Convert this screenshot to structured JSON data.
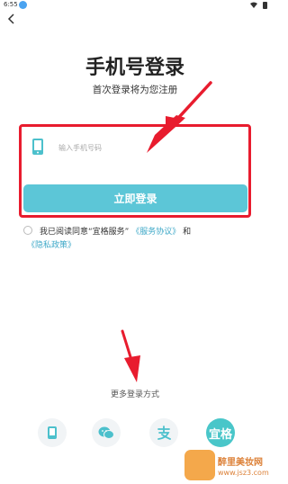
{
  "status_bar": {
    "time": "6:55",
    "notification_count": "0"
  },
  "header": {
    "title": "手机号登录",
    "subtitle": "首次登录将为您注册"
  },
  "phone_input": {
    "placeholder": "输入手机号码",
    "value": ""
  },
  "login_button": {
    "label": "立即登录"
  },
  "agreement": {
    "prefix": "我已阅读同意“宜格服务”",
    "service_link": "《服务协议》",
    "conjunction": "和",
    "privacy_link": "《隐私政策》"
  },
  "more_login": {
    "label": "更多登录方式"
  },
  "methods": [
    {
      "name": "phone",
      "icon": "phone-icon"
    },
    {
      "name": "wechat",
      "icon": "wechat-icon"
    },
    {
      "name": "alipay",
      "icon": "alipay-icon"
    },
    {
      "name": "yige",
      "icon": "yige-icon",
      "label": "宜格"
    }
  ],
  "watermark": {
    "brand": "醉里美妆网",
    "url": "www.jsz3.com"
  },
  "colors": {
    "accent": "#5cc6d7",
    "link": "#3fa9c8",
    "annotation_red": "#e81c2e"
  }
}
